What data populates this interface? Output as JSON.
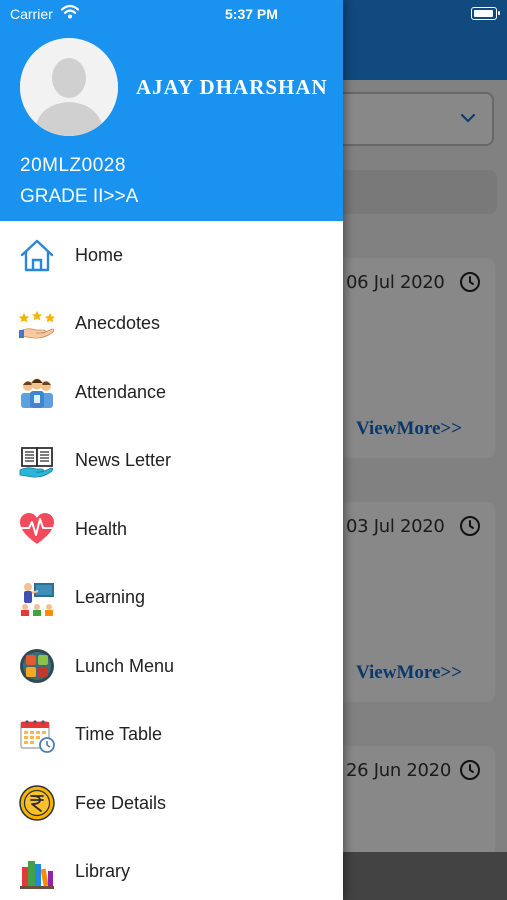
{
  "status_bar": {
    "carrier": "Carrier",
    "time": "5:37 PM"
  },
  "drawer": {
    "user": {
      "name": "AJAY DHARSHAN",
      "id": "20MLZ0028",
      "grade": "GRADE II>>A"
    },
    "menu": [
      {
        "label": "Home",
        "icon": "home-icon"
      },
      {
        "label": "Anecdotes",
        "icon": "anecdotes-icon"
      },
      {
        "label": "Attendance",
        "icon": "attendance-icon"
      },
      {
        "label": "News Letter",
        "icon": "newsletter-icon"
      },
      {
        "label": "Health",
        "icon": "health-icon"
      },
      {
        "label": "Learning",
        "icon": "learning-icon"
      },
      {
        "label": "Lunch Menu",
        "icon": "lunch-menu-icon"
      },
      {
        "label": "Time Table",
        "icon": "timetable-icon"
      },
      {
        "label": "Fee Details",
        "icon": "fee-icon"
      },
      {
        "label": "Library",
        "icon": "library-icon"
      }
    ]
  },
  "background": {
    "cards": [
      {
        "date": "06 Jul 2020",
        "more": "ViewMore>>"
      },
      {
        "date": "03 Jul 2020",
        "more": "ViewMore>>"
      },
      {
        "date": "26 Jun 2020"
      }
    ]
  },
  "colors": {
    "header_blue": "#1a93f0",
    "link_blue": "#1565c0"
  }
}
